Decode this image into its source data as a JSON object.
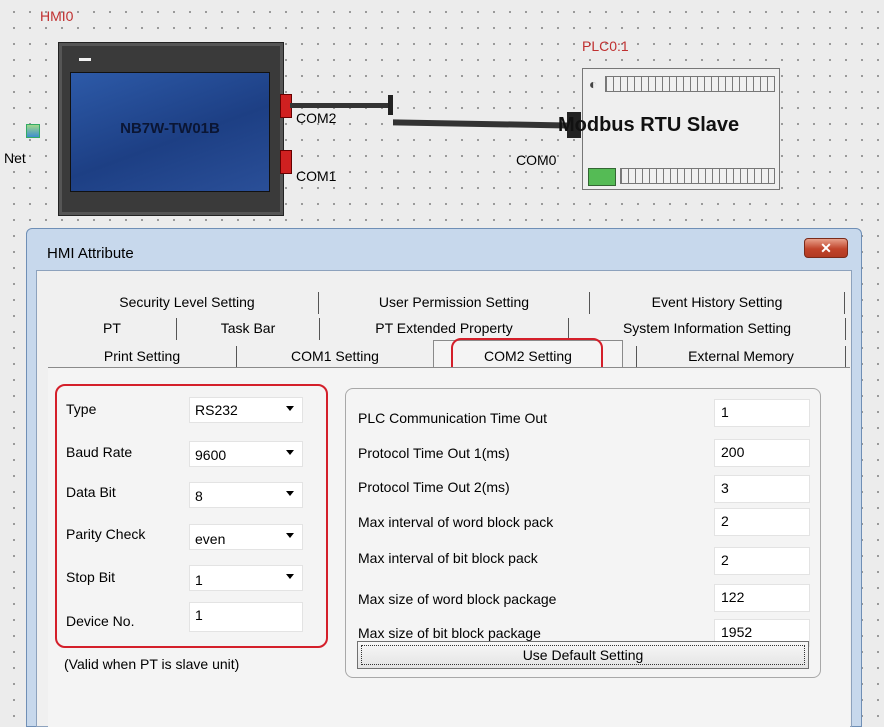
{
  "canvas": {
    "hmi": {
      "name": "HMI0",
      "model": "NB7W-TW01B",
      "net_label": "Net",
      "ports": [
        "COM2",
        "COM1"
      ]
    },
    "plc": {
      "name": "PLC0:1",
      "title": "Modbus RTU Slave",
      "port": "COM0"
    }
  },
  "dialog": {
    "title": "HMI Attribute",
    "close_label": "✕",
    "tabs_row1": [
      "Security Level Setting",
      "User Permission Setting",
      "Event History Setting"
    ],
    "tabs_row2": [
      "PT",
      "Task Bar",
      "PT Extended Property",
      "System Information Setting"
    ],
    "tabs_row3": [
      "Print Setting",
      "COM1 Setting",
      "COM2 Setting",
      "External Memory"
    ],
    "active_tab": "COM2 Setting",
    "com_settings": {
      "type_label": "Type",
      "type_value": "RS232",
      "baud_label": "Baud Rate",
      "baud_value": "9600",
      "databit_label": "Data Bit",
      "databit_value": "8",
      "parity_label": "Parity Check",
      "parity_value": "even",
      "stopbit_label": "Stop Bit",
      "stopbit_value": "1",
      "device_label": "Device No.",
      "device_value": "1",
      "note": "(Valid when PT is slave unit)"
    },
    "protocol": [
      {
        "label": "PLC Communication Time Out",
        "value": "1"
      },
      {
        "label": "Protocol Time Out 1(ms)",
        "value": "200"
      },
      {
        "label": "Protocol Time Out 2(ms)",
        "value": "3"
      },
      {
        "label": "Max interval of word block pack",
        "value": "2"
      },
      {
        "label": "Max interval of bit block pack",
        "value": "2"
      },
      {
        "label": "Max size of word block package",
        "value": "122"
      },
      {
        "label": "Max size of bit block package",
        "value": "1952"
      }
    ],
    "default_button": "Use Default Setting"
  },
  "colors": {
    "highlight": "#d41f2a",
    "device_label": "#c03030",
    "hmi_screen": "#2d5aa8"
  }
}
